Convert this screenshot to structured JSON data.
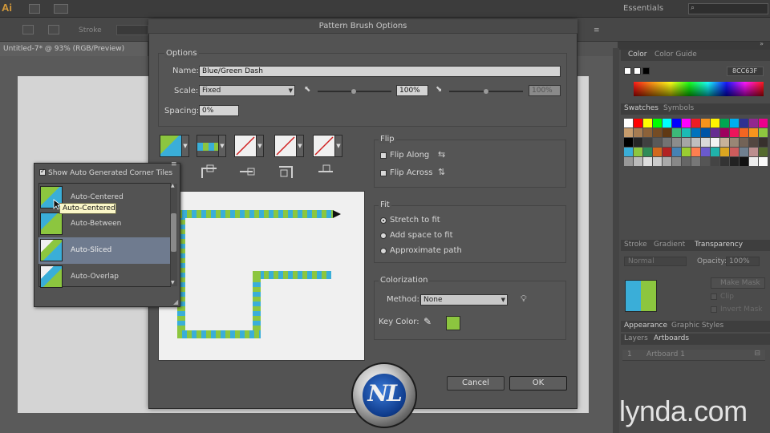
{
  "app": {
    "logo": "Ai",
    "workspace": "Essentials",
    "document_tab": "Untitled-7* @ 93% (RGB/Preview)",
    "stroke_label": "Stroke"
  },
  "panels": {
    "color_tabs": [
      "Color",
      "Color Guide"
    ],
    "hex_value": "8CC63F",
    "swatch_tabs": [
      "Swatches",
      "Symbols"
    ],
    "stroke_tabs": [
      "Stroke",
      "Gradient",
      "Transparency"
    ],
    "blend_mode": "Normal",
    "opacity_label": "Opacity:",
    "opacity_value": "100%",
    "make_mask": "Make Mask",
    "clip": "Clip",
    "invert_mask": "Invert Mask",
    "appearance_tabs": [
      "Appearance",
      "Graphic Styles"
    ],
    "layers_tabs": [
      "Layers",
      "Artboards"
    ],
    "artboard_index": "1",
    "artboard_name": "Artboard 1"
  },
  "dialog": {
    "title": "Pattern Brush Options",
    "options_label": "Options",
    "name_label": "Name:",
    "name_value": "Blue/Green Dash",
    "scale_label": "Scale:",
    "scale_mode": "Fixed",
    "scale_value": "100%",
    "scale_value_dim": "100%",
    "spacing_label": "Spacing:",
    "spacing_value": "0%",
    "flip_label": "Flip",
    "flip_along": "Flip Along",
    "flip_across": "Flip Across",
    "fit_label": "Fit",
    "fit_options": [
      "Stretch to fit",
      "Add space to fit",
      "Approximate path"
    ],
    "fit_selected": 0,
    "colorization_label": "Colorization",
    "method_label": "Method:",
    "method_value": "None",
    "key_color_label": "Key Color:",
    "key_color": "#8CC63F",
    "cancel": "Cancel",
    "ok": "OK"
  },
  "popup": {
    "show_label": "Show Auto Generated Corner Tiles",
    "items": [
      "Auto-Centered",
      "Auto-Between",
      "Auto-Sliced",
      "Auto-Overlap"
    ],
    "selected": "Auto-Sliced",
    "tooltip": "Auto-Centered"
  },
  "colors": {
    "pattern_blue": "#3aaed8",
    "pattern_green": "#8cc63f",
    "selection": "#6f7b8f"
  },
  "watermark": {
    "lynda": "lynda.com"
  }
}
